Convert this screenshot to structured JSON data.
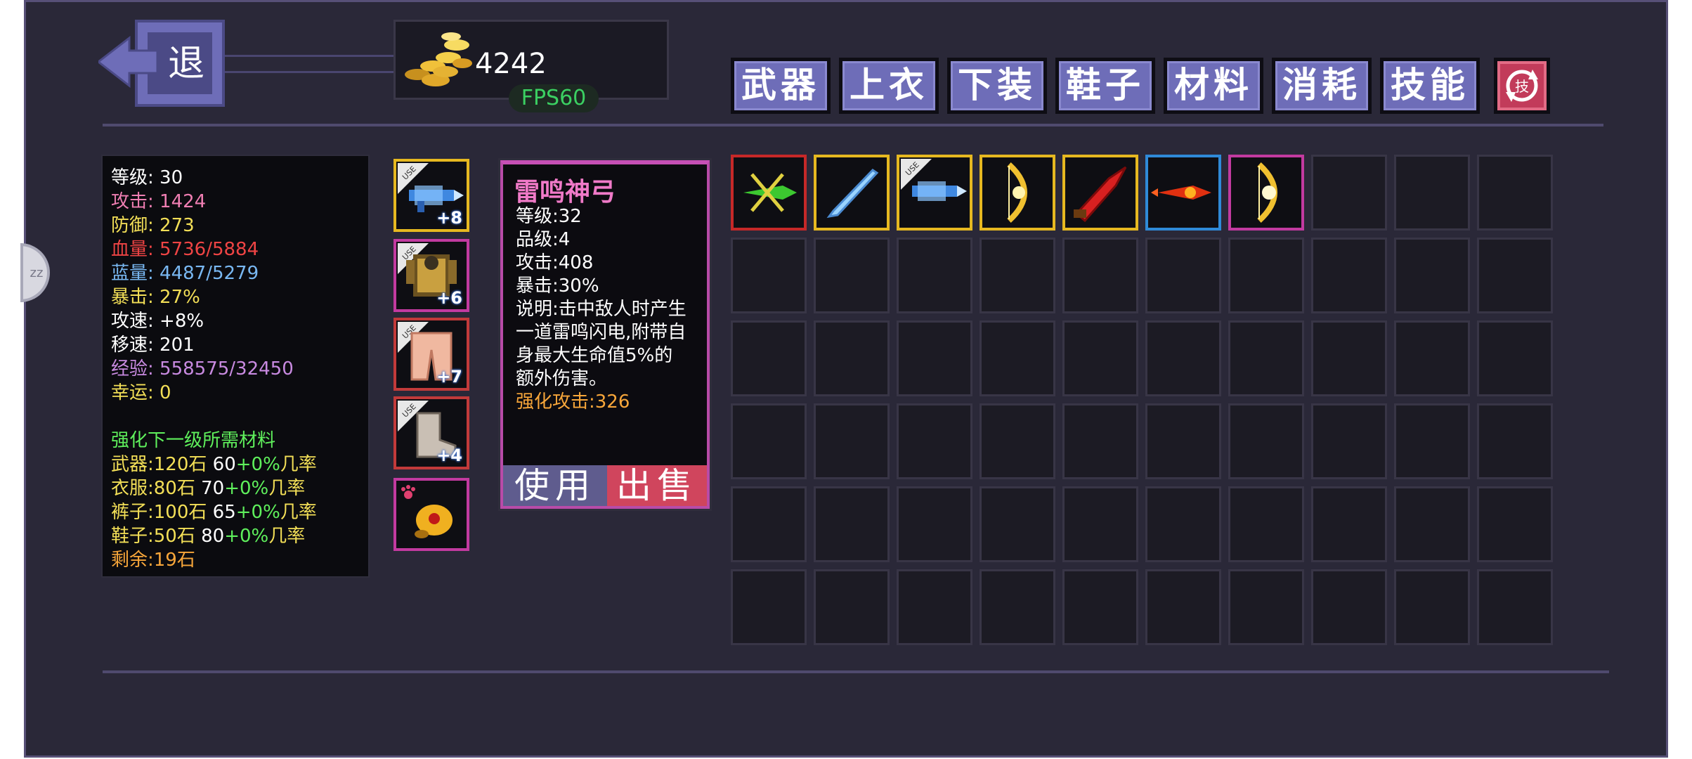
{
  "side_tab": "zz",
  "back": {
    "label": "退"
  },
  "gold": {
    "value": "4242"
  },
  "fps": "FPS60",
  "tabs": [
    {
      "label": "武器"
    },
    {
      "label": "上衣"
    },
    {
      "label": "下装"
    },
    {
      "label": "鞋子"
    },
    {
      "label": "材料"
    },
    {
      "label": "消耗"
    },
    {
      "label": "技能"
    }
  ],
  "skill_button_glyph": "技",
  "stats": {
    "level": {
      "label": "等级:",
      "value": "30"
    },
    "attack": {
      "label": "攻击:",
      "value": "1424"
    },
    "defense": {
      "label": "防御:",
      "value": "273"
    },
    "hp": {
      "label": "血量:",
      "value": "5736/5884"
    },
    "mp": {
      "label": "蓝量:",
      "value": "4487/5279"
    },
    "crit": {
      "label": "暴击:",
      "value": "27%"
    },
    "atk_speed": {
      "label": "攻速:",
      "value": "+8%"
    },
    "move_speed": {
      "label": "移速:",
      "value": "201"
    },
    "exp": {
      "label": "经验:",
      "value": "558575/32450"
    },
    "luck": {
      "label": "幸运:",
      "value": "0"
    },
    "materials_title": "强化下一级所需材料",
    "materials": [
      {
        "label": "武器:120石",
        "count": " 60",
        "rate": "+0%",
        "suffix": "几率"
      },
      {
        "label": "衣服:80石",
        "count": " 70",
        "rate": "+0%",
        "suffix": "几率"
      },
      {
        "label": "裤子:100石",
        "count": " 65",
        "rate": "+0%",
        "suffix": "几率"
      },
      {
        "label": "鞋子:50石",
        "count": " 80",
        "rate": "+0%",
        "suffix": "几率"
      }
    ],
    "remaining": "剩余:19石"
  },
  "equipped": [
    {
      "slot": "weapon",
      "plus": "+8",
      "badge": "USE",
      "border": "#e6b820"
    },
    {
      "slot": "armor",
      "plus": "+6",
      "badge": "USE",
      "border": "#c23aa0"
    },
    {
      "slot": "pants",
      "plus": "+7",
      "badge": "USE",
      "border": "#c23a3a"
    },
    {
      "slot": "boots",
      "plus": "+4",
      "badge": "USE",
      "border": "#c23a3a"
    },
    {
      "slot": "pet",
      "plus": "",
      "badge": "",
      "border": "#c23aa0"
    }
  ],
  "detail": {
    "name": "雷鸣神弓",
    "lines": [
      "等级:32",
      "品级:4",
      "攻击:408",
      "暴击:30%",
      "说明:击中敌人时产生一道雷鸣闪电,附带自身最大生命值5%的额外伤害。"
    ],
    "enhance": "强化攻击:326",
    "use_label": "使用",
    "sell_label": "出售"
  },
  "inventory": [
    {
      "icon": "green-crossbow-icon",
      "border": "#c62828"
    },
    {
      "icon": "ice-sword-icon",
      "border": "#e6b820"
    },
    {
      "icon": "ice-gun-icon",
      "border": "#e6b820",
      "badge": "USE"
    },
    {
      "icon": "golden-bow-icon",
      "border": "#e6b820"
    },
    {
      "icon": "red-blade-icon",
      "border": "#e6b820"
    },
    {
      "icon": "fire-rocket-icon",
      "border": "#2f8ad8"
    },
    {
      "icon": "thunder-bow-icon",
      "border": "#c23aa0"
    }
  ],
  "colors": {
    "panel": "#2a2838",
    "tab": "#6e6db8",
    "accent_pink": "#f07ac8",
    "fps_green": "#3bd062"
  }
}
